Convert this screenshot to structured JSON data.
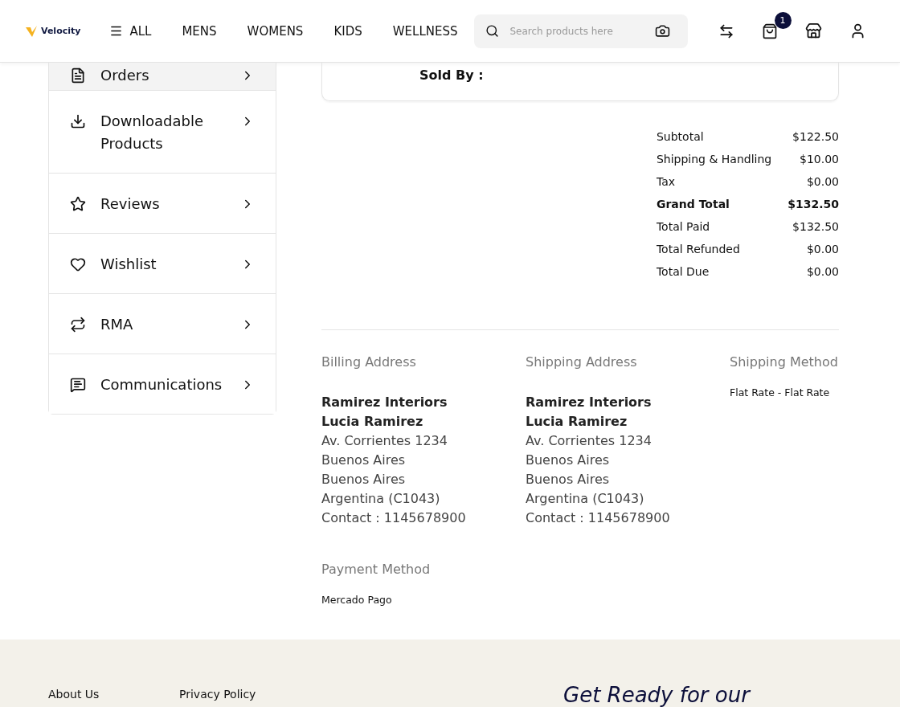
{
  "header": {
    "logo": "Velocity",
    "nav": [
      {
        "label": "ALL",
        "kind": "menu"
      },
      {
        "label": "MENS",
        "kind": "link"
      },
      {
        "label": "WOMENS",
        "kind": "link"
      },
      {
        "label": "KIDS",
        "kind": "link"
      },
      {
        "label": "WELLNESS",
        "kind": "link"
      }
    ],
    "search": {
      "placeholder": "Search products here"
    },
    "cart_count": "1"
  },
  "sidebar": {
    "items": [
      {
        "label": "Orders",
        "selected": true
      },
      {
        "label": "Downloadable Products",
        "selected": false
      },
      {
        "label": "Reviews",
        "selected": false
      },
      {
        "label": "Wishlist",
        "selected": false
      },
      {
        "label": "RMA",
        "selected": false
      },
      {
        "label": "Communications",
        "selected": false
      }
    ]
  },
  "item_card": {
    "sold_by_label": "Sold By :"
  },
  "totals": [
    {
      "label": "Subtotal",
      "value": "$122.50",
      "bold": false
    },
    {
      "label": "Shipping & Handling",
      "value": "$10.00",
      "bold": false
    },
    {
      "label": "Tax",
      "value": "$0.00",
      "bold": false
    },
    {
      "label": "Grand Total",
      "value": "$132.50",
      "bold": true
    },
    {
      "label": "Total Paid",
      "value": "$132.50",
      "bold": false
    },
    {
      "label": "Total Refunded",
      "value": "$0.00",
      "bold": false
    },
    {
      "label": "Total Due",
      "value": "$0.00",
      "bold": false
    }
  ],
  "addresses": [
    {
      "title": "Billing Address",
      "company": "Ramirez Interiors",
      "name": "Lucia Ramirez",
      "lines": [
        "Av. Corrientes 1234",
        "Buenos Aires",
        "Buenos Aires",
        "Argentina (C1043)",
        "Contact : 1145678900"
      ]
    },
    {
      "title": "Shipping Address",
      "company": "Ramirez Interiors",
      "name": "Lucia Ramirez",
      "lines": [
        "Av. Corrientes 1234",
        "Buenos Aires",
        "Buenos Aires",
        "Argentina (C1043)",
        "Contact : 1145678900"
      ]
    }
  ],
  "shipping_method": {
    "title": "Shipping Method",
    "value": "Flat Rate - Flat Rate"
  },
  "payment_method": {
    "title": "Payment Method",
    "value": "Mercado Pago"
  },
  "footer": {
    "links": [
      "About Us",
      "Privacy Policy"
    ],
    "headline": "Get Ready for our"
  }
}
